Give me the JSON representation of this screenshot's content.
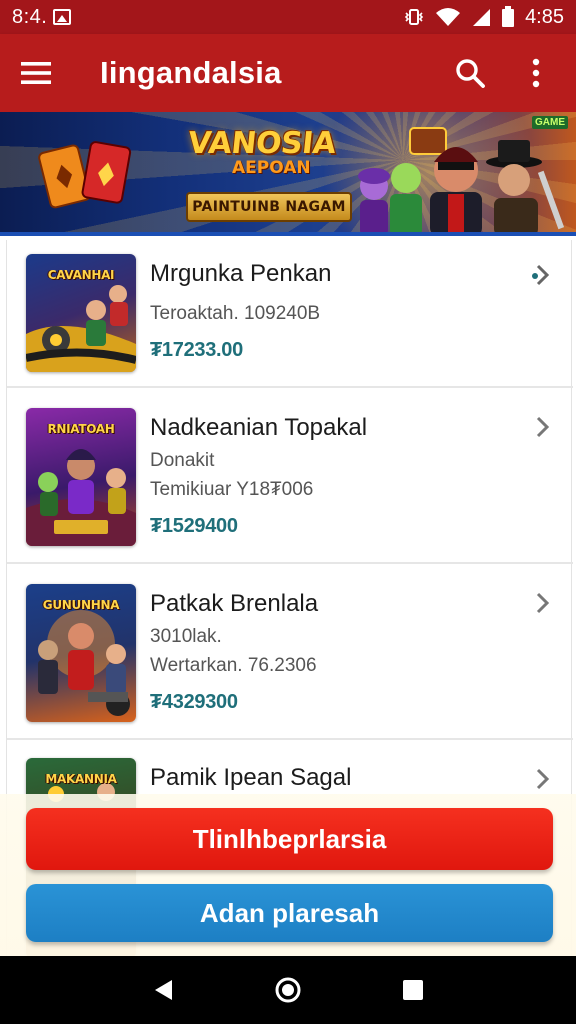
{
  "status_bar": {
    "time": "8:4.",
    "clock_right": "4:85",
    "icons": [
      "image-icon",
      "vibrate-icon",
      "wifi-icon",
      "signal-icon",
      "battery-icon"
    ]
  },
  "app_bar": {
    "title": "Iingandalsia",
    "icons": [
      "menu-icon",
      "search-icon",
      "more-vert-icon"
    ],
    "color": "#b71c1c"
  },
  "banner": {
    "logo_main": "VANOSIA",
    "logo_sub": "AEPOAN",
    "plate": "PAINTUINB NAGAM",
    "corner_tag": "GAME"
  },
  "items": [
    {
      "name": "Mrgunka Penkan",
      "meta_lines": [
        "Teroaktah. 109240B"
      ],
      "price": "₮17233.00",
      "thumb_title": "CAVANHAI"
    },
    {
      "name": "Nadkeanian Topakal",
      "meta_lines": [
        "Donakit",
        "Temikiuar Y18₮006"
      ],
      "price": "₮1529400",
      "thumb_title": "RNIATOAH"
    },
    {
      "name": "Patkak Brenlala",
      "meta_lines": [
        "3010lak.",
        "Wertarkan. 76.2306"
      ],
      "price": "₮4329300",
      "thumb_title": "GUNUNHNA"
    },
    {
      "name": "Pamik Ipean Sagal",
      "meta_lines": [],
      "price": "",
      "thumb_title": "MAKANNIA"
    }
  ],
  "buttons": {
    "primary": "Tlinlhbeprlarsia",
    "secondary": "Adan plaresah"
  },
  "colors": {
    "accent_red": "#e0170e",
    "accent_blue": "#1d7fc4",
    "price": "#1f6f7a"
  },
  "nav_bar": {
    "icons": [
      "back-icon",
      "home-icon",
      "recents-icon"
    ]
  }
}
